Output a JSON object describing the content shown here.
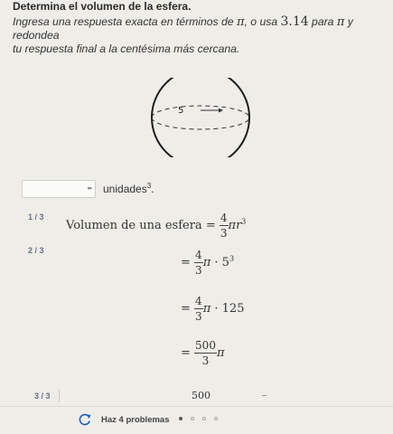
{
  "question": {
    "title": "Determina el volumen de la esfera.",
    "instruction_line1_a": "Ingresa una respuesta exacta en términos de ",
    "pi": "π",
    "instruction_line1_b": ", o usa ",
    "approx_value": "3.14",
    "instruction_line1_c": " para ",
    "instruction_line1_d": " y redondea",
    "instruction_line2": "tu respuesta final a la centésima más cercana."
  },
  "figure": {
    "radius_label": "5"
  },
  "answer": {
    "value": "",
    "keyboard_icon": "keyboard-icon",
    "units_text": "unidades",
    "units_exponent": "3",
    "units_period": "."
  },
  "steps": [
    {
      "number": "1 / 3",
      "lhs": "Volumen de una esfera",
      "eq": "=",
      "frac_num": "4",
      "frac_den": "3",
      "pi": "π",
      "var": "r",
      "exp": "3"
    },
    {
      "number": "2 / 3",
      "lines": [
        {
          "eq": "=",
          "frac_num": "4",
          "frac_den": "3",
          "pi": "π",
          "dot": "·",
          "base": "5",
          "exp": "3"
        },
        {
          "eq": "=",
          "frac_num": "4",
          "frac_den": "3",
          "pi": "π",
          "dot": "·",
          "value": "125"
        },
        {
          "eq": "=",
          "frac_num": "500",
          "frac_den": "3",
          "pi": "π"
        }
      ]
    },
    {
      "number": "3 / 3",
      "value": "500"
    }
  ],
  "footer": {
    "refresh_icon": "refresh-icon",
    "label": "Haz 4 problemas",
    "progress_total": 4,
    "progress_done": 1
  },
  "colors": {
    "background": "#eeede8",
    "step_number": "#6b6f84",
    "refresh_icon": "#1f5fb8"
  }
}
